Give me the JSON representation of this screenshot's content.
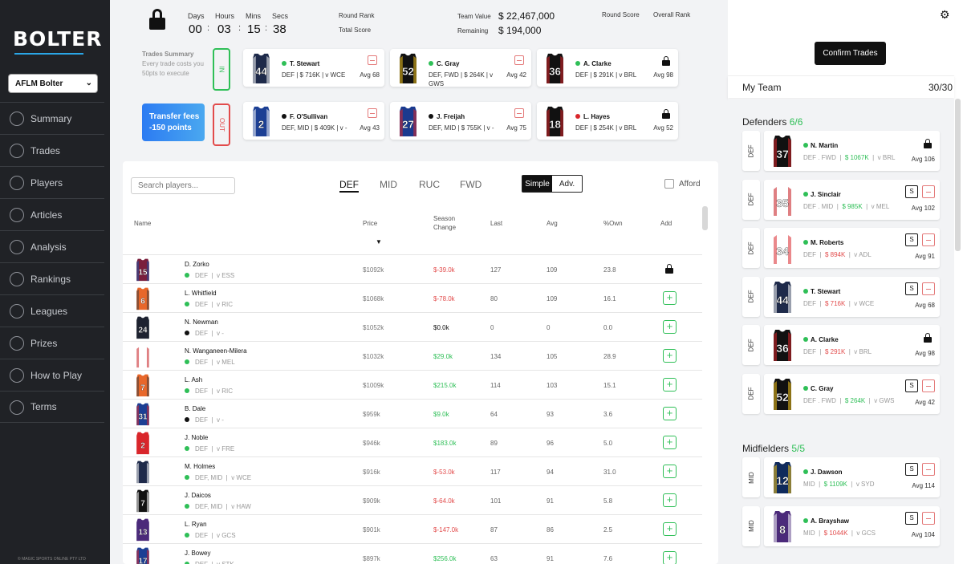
{
  "app": {
    "logo_text": "BOLTER",
    "competition": "AFLM Bolter",
    "copyright": "© MAGIC SPORTS ONLINE PTY LTD"
  },
  "nav": [
    {
      "label": "Summary",
      "icon": "summary-icon"
    },
    {
      "label": "Trades",
      "icon": "trades-icon"
    },
    {
      "label": "Players",
      "icon": "players-icon"
    },
    {
      "label": "Articles",
      "icon": "articles-icon"
    },
    {
      "label": "Analysis",
      "icon": "analysis-icon"
    },
    {
      "label": "Rankings",
      "icon": "rankings-icon"
    },
    {
      "label": "Leagues",
      "icon": "leagues-icon"
    },
    {
      "label": "Prizes",
      "icon": "prizes-icon"
    },
    {
      "label": "How to Play",
      "icon": "how-to-play-icon"
    },
    {
      "label": "Terms",
      "icon": "terms-icon"
    }
  ],
  "timer": {
    "days_label": "Days",
    "days": "00",
    "hours_label": "Hours",
    "hours": "03",
    "mins_label": "Mins",
    "mins": "15",
    "secs_label": "Secs",
    "secs": "38"
  },
  "stats": {
    "round_rank_label": "Round Rank",
    "total_score_label": "Total Score",
    "team_value_label": "Team Value",
    "team_value": "$ 22,467,000",
    "remaining_label": "Remaining",
    "remaining": "$ 194,000",
    "round_score_label": "Round Score",
    "overall_rank_label": "Overall Rank"
  },
  "trades": {
    "summary_title": "Trades Summary",
    "summary_text": "Every trade costs you 50pts to execute",
    "fees_line1": "Transfer fees",
    "fees_line2": "-150 points",
    "in_label": "IN",
    "out_label": "OUT",
    "in_players": [
      {
        "name": "T. Stewart",
        "info": "DEF | $ 716K | v WCE",
        "avg": "Avg 68",
        "dot": "#2fbf57",
        "number": "44",
        "jersey": "#1e2a4a",
        "jersey2": "#ffffff",
        "action": "minus"
      },
      {
        "name": "C. Gray",
        "info": "DEF, FWD | $ 264K | v GWS",
        "avg": "Avg 42",
        "dot": "#2fbf57",
        "number": "52",
        "jersey": "#111111",
        "jersey2": "#f2c21b",
        "action": "minus"
      },
      {
        "name": "A. Clarke",
        "info": "DEF | $ 291K | v BRL",
        "avg": "Avg 98",
        "dot": "#2fbf57",
        "number": "36",
        "jersey": "#111111",
        "jersey2": "#d9262b",
        "action": "lock"
      }
    ],
    "out_players": [
      {
        "name": "F. O'Sullivan",
        "info": "DEF, MID | $ 409K | v -",
        "avg": "Avg 43",
        "dot": "#111111",
        "number": "2",
        "jersey": "#1c3f94",
        "jersey2": "#ffffff",
        "action": "minus"
      },
      {
        "name": "J. Freijah",
        "info": "DEF, MID | $ 755K | v -",
        "avg": "Avg 75",
        "dot": "#111111",
        "number": "27",
        "jersey": "#1a3a8f",
        "jersey2": "#d9262b",
        "action": "minus"
      },
      {
        "name": "L. Hayes",
        "info": "DEF | $ 254K | v BRL",
        "avg": "Avg 52",
        "dot": "#d9262b",
        "number": "18",
        "jersey": "#111111",
        "jersey2": "#d9262b",
        "action": "lock"
      }
    ]
  },
  "players_panel": {
    "search_placeholder": "Search players...",
    "tabs": [
      "DEF",
      "MID",
      "RUC",
      "FWD"
    ],
    "mode_simple": "Simple",
    "mode_adv": "Adv.",
    "afford_label": "Afford",
    "headers": {
      "name": "Name",
      "price": "Price",
      "season_change_1": "Season",
      "season_change_2": "Change",
      "last": "Last",
      "avg": "Avg",
      "own": "%Own",
      "add": "Add"
    },
    "rows": [
      {
        "name": "D. Zorko",
        "pos": "DEF",
        "opp": "v ESS",
        "dot": "#2fbf57",
        "price": "$1092k",
        "change": "$-39.0k",
        "change_color": "#e24b4b",
        "last": "127",
        "avg": "109",
        "own": "23.8",
        "action": "lock",
        "number": "15",
        "jersey": "#7a1f3d",
        "jersey2": "#1b4fa0"
      },
      {
        "name": "L. Whitfield",
        "pos": "DEF",
        "opp": "v RIC",
        "dot": "#2fbf57",
        "price": "$1068k",
        "change": "$-78.0k",
        "change_color": "#e24b4b",
        "last": "80",
        "avg": "109",
        "own": "16.1",
        "action": "add",
        "number": "6",
        "jersey": "#e8672a",
        "jersey2": "#3a3a3a"
      },
      {
        "name": "N. Newman",
        "pos": "DEF",
        "opp": "v -",
        "dot": "#111111",
        "price": "$1052k",
        "change": "$0.0k",
        "change_color": "#111111",
        "last": "0",
        "avg": "0",
        "own": "0.0",
        "action": "add",
        "number": "24",
        "jersey": "#1e2230",
        "jersey2": "#1e2230"
      },
      {
        "name": "N. Wanganeen-Milera",
        "pos": "DEF",
        "opp": "v MEL",
        "dot": "#2fbf57",
        "price": "$1032k",
        "change": "$29.0k",
        "change_color": "#2fbf57",
        "last": "134",
        "avg": "105",
        "own": "28.9",
        "action": "add",
        "number": "",
        "jersey": "#ffffff",
        "jersey2": "#c4161c"
      },
      {
        "name": "L. Ash",
        "pos": "DEF",
        "opp": "v RIC",
        "dot": "#2fbf57",
        "price": "$1009k",
        "change": "$215.0k",
        "change_color": "#2fbf57",
        "last": "114",
        "avg": "103",
        "own": "15.1",
        "action": "add",
        "number": "7",
        "jersey": "#e8672a",
        "jersey2": "#3a3a3a"
      },
      {
        "name": "B. Dale",
        "pos": "DEF",
        "opp": "v -",
        "dot": "#111111",
        "price": "$959k",
        "change": "$9.0k",
        "change_color": "#2fbf57",
        "last": "64",
        "avg": "93",
        "own": "3.6",
        "action": "add",
        "number": "31",
        "jersey": "#1c3f94",
        "jersey2": "#d9262b"
      },
      {
        "name": "J. Noble",
        "pos": "DEF",
        "opp": "v FRE",
        "dot": "#2fbf57",
        "price": "$946k",
        "change": "$183.0k",
        "change_color": "#2fbf57",
        "last": "89",
        "avg": "96",
        "own": "5.0",
        "action": "add",
        "number": "2",
        "jersey": "#d9262b",
        "jersey2": "#d9262b"
      },
      {
        "name": "M. Holmes",
        "pos": "DEF, MID",
        "opp": "v WCE",
        "dot": "#2fbf57",
        "price": "$916k",
        "change": "$-53.0k",
        "change_color": "#e24b4b",
        "last": "117",
        "avg": "94",
        "own": "31.0",
        "action": "add",
        "number": "",
        "jersey": "#1e2a4a",
        "jersey2": "#ffffff"
      },
      {
        "name": "J. Daicos",
        "pos": "DEF, MID",
        "opp": "v HAW",
        "dot": "#2fbf57",
        "price": "$909k",
        "change": "$-64.0k",
        "change_color": "#e24b4b",
        "last": "101",
        "avg": "91",
        "own": "5.8",
        "action": "add",
        "number": "7",
        "jersey": "#111111",
        "jersey2": "#ffffff"
      },
      {
        "name": "L. Ryan",
        "pos": "DEF",
        "opp": "v GCS",
        "dot": "#2fbf57",
        "price": "$901k",
        "change": "$-147.0k",
        "change_color": "#e24b4b",
        "last": "87",
        "avg": "86",
        "own": "2.5",
        "action": "add",
        "number": "13",
        "jersey": "#4b2a7a",
        "jersey2": "#4b2a7a"
      },
      {
        "name": "J. Bowey",
        "pos": "DEF",
        "opp": "v STK",
        "dot": "#2fbf57",
        "price": "$897k",
        "change": "$256.0k",
        "change_color": "#2fbf57",
        "last": "63",
        "avg": "91",
        "own": "7.6",
        "action": "add",
        "number": "17",
        "jersey": "#1c3f94",
        "jersey2": "#d9262b"
      }
    ]
  },
  "my_team": {
    "confirm_label": "Confirm Trades",
    "title": "My Team",
    "count": "30/30",
    "defenders_label": "Defenders",
    "defenders_count": "6/6",
    "midfielders_label": "Midfielders",
    "midfielders_count": "5/5",
    "s_label": "S",
    "defenders": [
      {
        "pos": "DEF",
        "name": "N. Martin",
        "role": "DEF . FWD",
        "price": "$ 1067K",
        "price_neg": false,
        "opp": "v BRL",
        "avg": "Avg 106",
        "dot": "#2fbf57",
        "number": "37",
        "jersey": "#111111",
        "jersey2": "#d9262b",
        "action": "lock"
      },
      {
        "pos": "DEF",
        "name": "J. Sinclair",
        "role": "DEF . MID",
        "price": "$ 985K",
        "price_neg": false,
        "opp": "v MEL",
        "avg": "Avg 102",
        "dot": "#2fbf57",
        "number": "35",
        "jersey": "#ffffff",
        "jersey2": "#c4161c",
        "action": "swap"
      },
      {
        "pos": "DEF",
        "name": "M. Roberts",
        "role": "DEF",
        "price": "$ 894K",
        "price_neg": true,
        "opp": "v ADL",
        "avg": "Avg 91",
        "dot": "#2fbf57",
        "number": "34",
        "jersey": "#ffffff",
        "jersey2": "#d9262b",
        "action": "swap"
      },
      {
        "pos": "DEF",
        "name": "T. Stewart",
        "role": "DEF",
        "price": "$ 716K",
        "price_neg": true,
        "opp": "v WCE",
        "avg": "Avg 68",
        "dot": "#2fbf57",
        "number": "44",
        "jersey": "#1e2a4a",
        "jersey2": "#ffffff",
        "action": "swap"
      },
      {
        "pos": "DEF",
        "name": "A. Clarke",
        "role": "DEF",
        "price": "$ 291K",
        "price_neg": true,
        "opp": "v BRL",
        "avg": "Avg 98",
        "dot": "#2fbf57",
        "number": "36",
        "jersey": "#111111",
        "jersey2": "#d9262b",
        "action": "lock"
      },
      {
        "pos": "DEF",
        "name": "C. Gray",
        "role": "DEF . FWD",
        "price": "$ 264K",
        "price_neg": false,
        "opp": "v GWS",
        "avg": "Avg 42",
        "dot": "#2fbf57",
        "number": "52",
        "jersey": "#111111",
        "jersey2": "#f2c21b",
        "action": "swap"
      }
    ],
    "midfielders": [
      {
        "pos": "MID",
        "name": "J. Dawson",
        "role": "MID",
        "price": "$ 1109K",
        "price_neg": false,
        "opp": "v SYD",
        "avg": "Avg 114",
        "dot": "#2fbf57",
        "number": "12",
        "jersey": "#0f2a5c",
        "jersey2": "#f2c21b",
        "action": "swap"
      },
      {
        "pos": "MID",
        "name": "A. Brayshaw",
        "role": "MID",
        "price": "$ 1044K",
        "price_neg": true,
        "opp": "v GCS",
        "avg": "Avg 104",
        "dot": "#2fbf57",
        "number": "8",
        "jersey": "#4b2a7a",
        "jersey2": "#ffffff",
        "action": "swap"
      }
    ]
  }
}
